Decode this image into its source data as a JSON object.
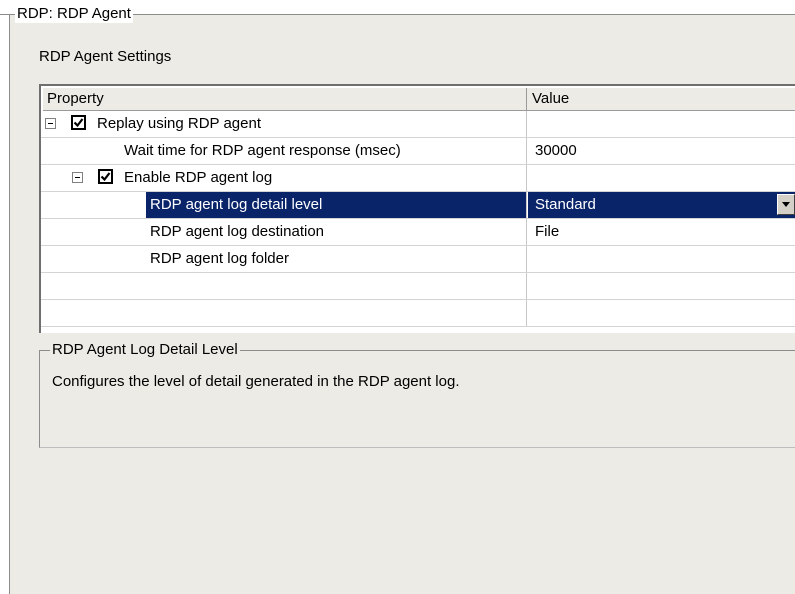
{
  "group": {
    "title": "RDP: RDP Agent"
  },
  "settings_label": "RDP Agent Settings",
  "grid": {
    "columns": {
      "property": "Property",
      "value": "Value"
    },
    "rows": [
      {
        "label": "Replay using RDP agent",
        "value": "",
        "expander": "minus",
        "checked": true
      },
      {
        "label": "Wait time for RDP agent response (msec)",
        "value": "30000"
      },
      {
        "label": "Enable RDP agent log",
        "value": "",
        "expander": "minus",
        "checked": true
      },
      {
        "label": "RDP agent log detail level",
        "value": "Standard",
        "selected": true,
        "has_dropdown": true
      },
      {
        "label": "RDP agent log destination",
        "value": "File"
      },
      {
        "label": "RDP agent log folder",
        "value": ""
      }
    ]
  },
  "description": {
    "title": "RDP Agent Log Detail Level",
    "text": "Configures the level of detail generated in the RDP agent log."
  },
  "colors": {
    "selection": "#0a246a",
    "panel": "#ecebe6"
  }
}
